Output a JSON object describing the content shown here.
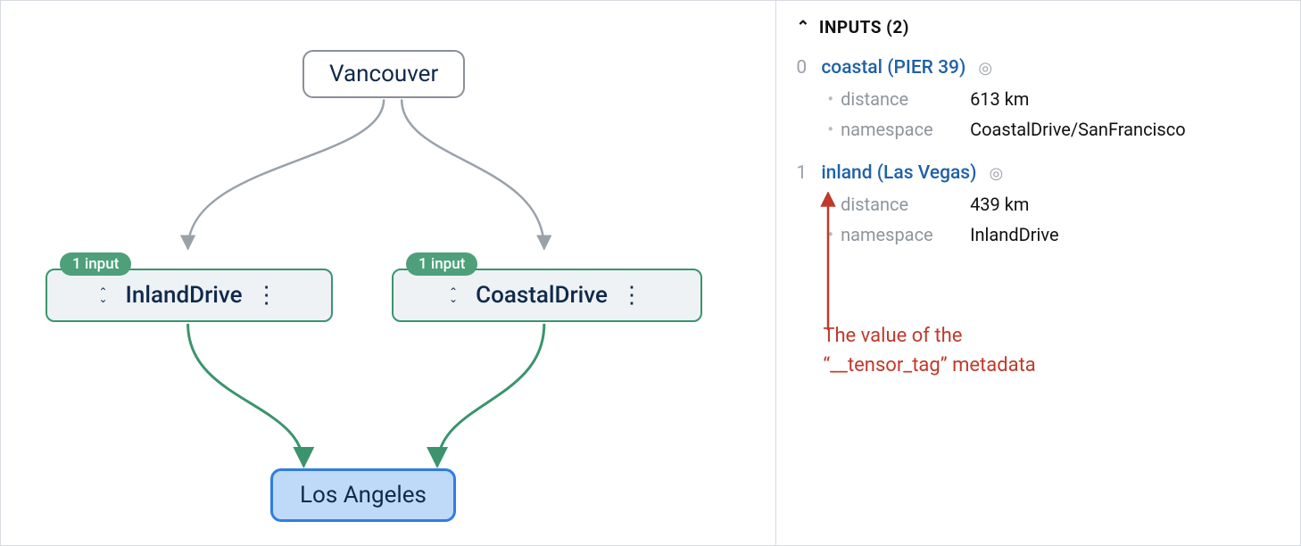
{
  "graph": {
    "source_node": "Vancouver",
    "sink_node": "Los Angeles",
    "ops": [
      {
        "label": "InlandDrive",
        "badge": "1 input"
      },
      {
        "label": "CoastalDrive",
        "badge": "1 input"
      }
    ]
  },
  "side": {
    "section_title": "INPUTS (2)",
    "items": [
      {
        "index": "0",
        "name": "coastal (PIER 39)",
        "props": [
          {
            "k": "distance",
            "v": "613 km"
          },
          {
            "k": "namespace",
            "v": "CoastalDrive/SanFrancisco"
          }
        ]
      },
      {
        "index": "1",
        "name": "inland (Las Vegas)",
        "props": [
          {
            "k": "distance",
            "v": "439 km"
          },
          {
            "k": "namespace",
            "v": "InlandDrive"
          }
        ]
      }
    ]
  },
  "annotation": {
    "line1": "The value of the",
    "line2": "“__tensor_tag” metadata"
  },
  "colors": {
    "edge_gray": "#9aa1a9",
    "edge_green": "#3b946d",
    "anno_red": "#c0392b"
  }
}
